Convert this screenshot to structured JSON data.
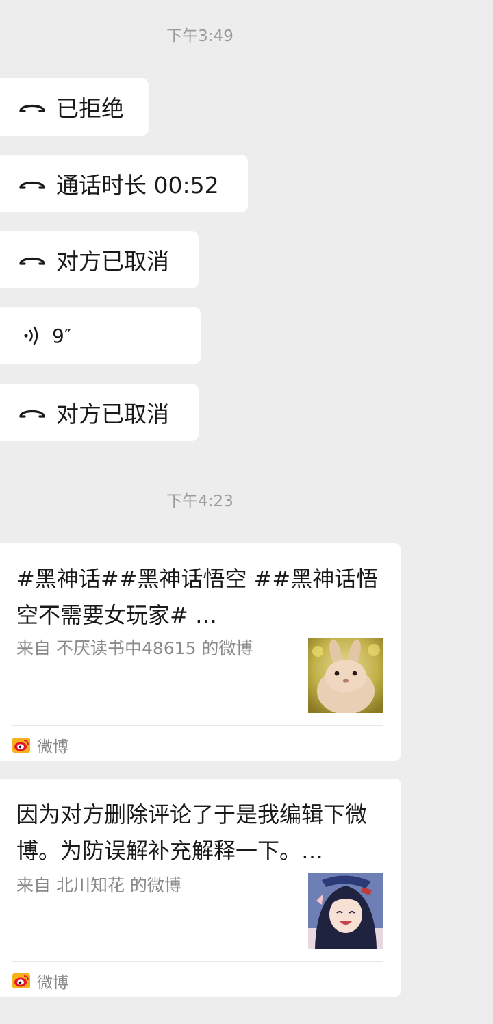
{
  "timestamps": [
    "下午3:49",
    "下午4:23"
  ],
  "calls": [
    {
      "icon": "hang-up-icon",
      "label": "已拒绝"
    },
    {
      "icon": "hang-up-icon",
      "label": "通话时长 00:52"
    },
    {
      "icon": "hang-up-icon",
      "label": "对方已取消"
    },
    {
      "icon": "voice-wave-icon",
      "label": "9″"
    },
    {
      "icon": "hang-up-icon",
      "label": "对方已取消"
    }
  ],
  "cards": [
    {
      "title": "#黑神话##黑神话悟空  ##黑神话悟空不需要女玩家# …",
      "source": "来自 不厌读书中48615 的微博",
      "thumb": "rabbit-photo",
      "app": "微博"
    },
    {
      "title": "因为对方删除评论了于是我编辑下微博。为防误解补充解释一下。…",
      "source": "来自 北川知花 的微博",
      "thumb": "anime-avatar",
      "app": "微博"
    }
  ]
}
